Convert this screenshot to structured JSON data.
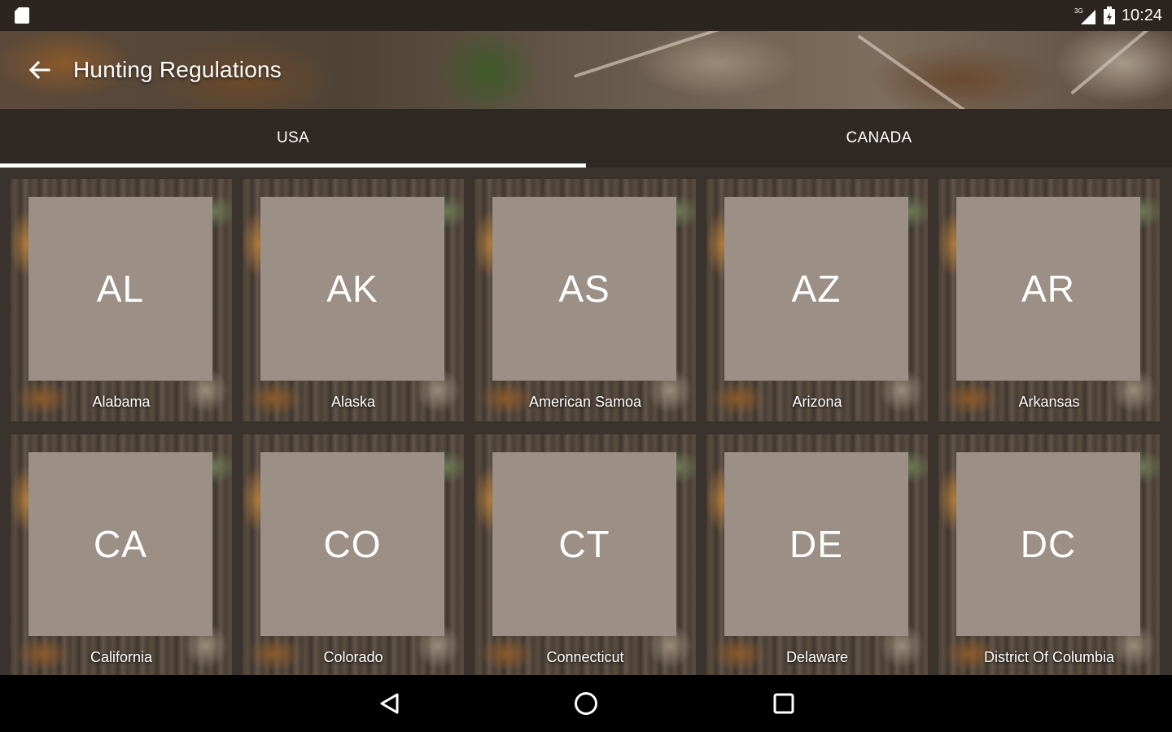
{
  "status_bar": {
    "time": "10:24",
    "network_label": "3G",
    "icons": [
      "sd-card-icon",
      "signal-icon",
      "battery-icon"
    ]
  },
  "app_bar": {
    "title": "Hunting Regulations",
    "back_icon": "arrow-left-icon"
  },
  "tabs": [
    {
      "label": "USA",
      "active": true
    },
    {
      "label": "CANADA",
      "active": false
    }
  ],
  "states": [
    {
      "abbr": "AL",
      "name": "Alabama"
    },
    {
      "abbr": "AK",
      "name": "Alaska"
    },
    {
      "abbr": "AS",
      "name": "American Samoa"
    },
    {
      "abbr": "AZ",
      "name": "Arizona"
    },
    {
      "abbr": "AR",
      "name": "Arkansas"
    },
    {
      "abbr": "CA",
      "name": "California"
    },
    {
      "abbr": "CO",
      "name": "Colorado"
    },
    {
      "abbr": "CT",
      "name": "Connecticut"
    },
    {
      "abbr": "DE",
      "name": "Delaware"
    },
    {
      "abbr": "DC",
      "name": "District Of Columbia"
    }
  ],
  "nav_bar": {
    "icons": [
      "back-triangle-icon",
      "home-circle-icon",
      "recents-square-icon"
    ]
  },
  "colors": {
    "status_bar": "#2b2420",
    "tab_bar": "#2f2926",
    "tile": "#9b8f86",
    "nav_bar": "#000000",
    "text": "#ffffff"
  }
}
